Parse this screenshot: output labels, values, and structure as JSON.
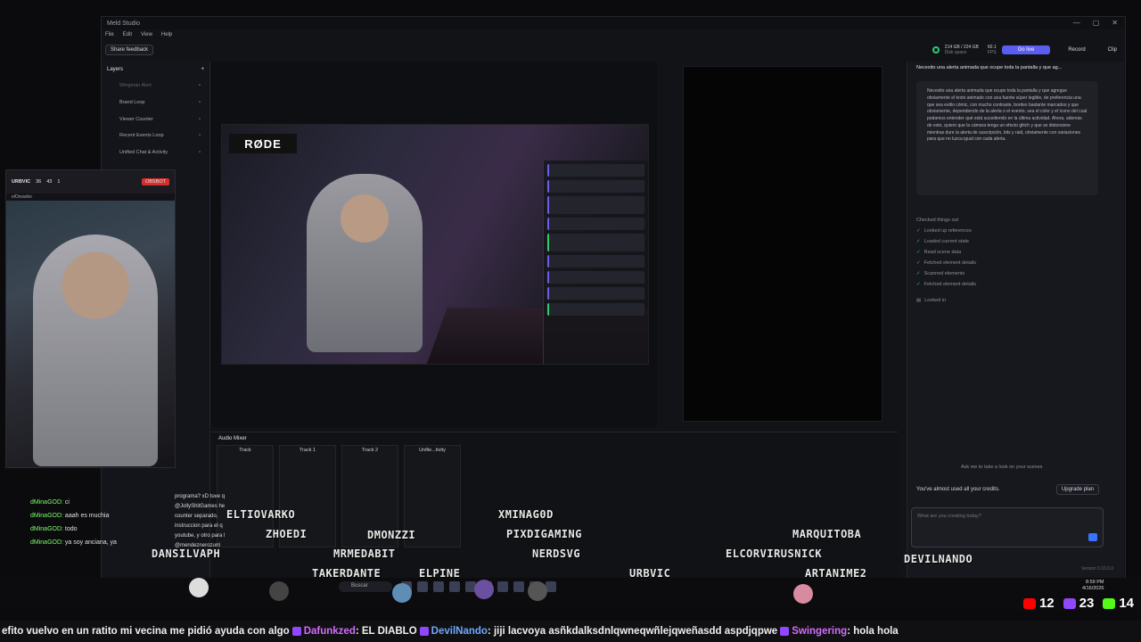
{
  "app": {
    "title": "Meld Studio",
    "min": "—",
    "max": "▢",
    "close": "✕"
  },
  "menu": [
    "File",
    "Edit",
    "View",
    "Help"
  ],
  "toolbar": {
    "feedback": "Share feedback",
    "disk": "214 GB / 224 GB",
    "disk_label": "Disk space",
    "fps": "60.1",
    "fps_label": "FPS",
    "golive": "Go live",
    "record": "Record",
    "clip": "Clip"
  },
  "layers": {
    "title": "Layers",
    "items": [
      "Wingman Alert",
      "Brand Loop",
      "Viewer Counter",
      "Recent Events Loop",
      "Unified Chat & Activity"
    ]
  },
  "video": {
    "brand": "RØDE"
  },
  "assistant": {
    "header": "Necesito una alerta animada que ocupe toda la pantalla y que ag...",
    "message": "Necesito una alerta animada que ocupe toda la pantalla y que agregue obviamente el texto animado con una fuente súper legible, de preferencia una que sea estilo cómic, con mucho contraste, bordes bastante marcados y que obviamente, dependiendo de la alerta o el evento, sea el color y el ícono del cual podamos entender qué está sucediendo en la última actividad. Ahora, además de esto, quiero que la cámara tenga un efecto glitch y que se distorsione mientras dure la alerta de suscripción, bits y raid, obviamente con variaciones para que no luzca igual con cada alerta.",
    "checked": "Checked things out",
    "steps": [
      "Looked up references",
      "Loaded current state",
      "Read scene data",
      "Fetched element details",
      "Scanned elements",
      "Fetched element details"
    ],
    "looked": "Looked in",
    "ask": "Ask me to take a look on your scenes",
    "credits": "You've almost used all your credits.",
    "upgrade": "Upgrade plan",
    "placeholder": "What are you creating today?",
    "version": "Version 0.10.0.0"
  },
  "mixer": {
    "title": "Audio Mixer",
    "tracks": [
      "Track",
      "Track 1",
      "Track 2",
      "Unifie...tivity"
    ]
  },
  "webcam": {
    "name": "URBVIC",
    "v1": "36",
    "v2": "43",
    "v3": "1",
    "tag": "OBSBOT",
    "sub": "elOovarko"
  },
  "chat": [
    {
      "user": "dMinaGOD:",
      "msg": "ci"
    },
    {
      "user": "dMinaGOD:",
      "msg": "aaah es muchia"
    },
    {
      "user": "dMinaGOD:",
      "msg": "todo"
    },
    {
      "user": "dMinaGOD:",
      "msg": "ya soy anciana, ya"
    }
  ],
  "chat2": [
    "programa? xD tuve q",
    "@JollyShitGames he",
    "counter separado,",
    "instruccion para el q",
    "youtube, y otro para l",
    "@mendeznerozurri"
  ],
  "names": [
    "ELTIOVARKO",
    "ZHOEDI",
    "DMONZZI",
    "XMINAG0D",
    "PIXDIGAMING",
    "NERDSVG",
    "MARQUITOBA",
    "DANSILVAPH",
    "MRMEDABIT",
    "TAKERDANTE",
    "ELPINE_",
    "URBVIC",
    "ELCORVIRUSNICK",
    "ARTANIME2",
    "DEVILNANDO"
  ],
  "taskbar": {
    "search": "Buscar",
    "time": "8:59 PM",
    "date": "4/16/2026"
  },
  "stats": {
    "yt": "12",
    "twitch": "23",
    "kick": "14"
  },
  "ticker": {
    "t1": "efito vuelvo en un ratito mi vecina me pidió ayuda con algo",
    "n1": "Dafunkzed",
    "t2": ": EL DIABLO",
    "n2": "DevilNando",
    "t3": ": jiji lacvoya asñkdalksdnlqwneqwñlejqweñasdd aspdjqpwe",
    "n3": "Swingering",
    "t4": ": hola hola"
  }
}
